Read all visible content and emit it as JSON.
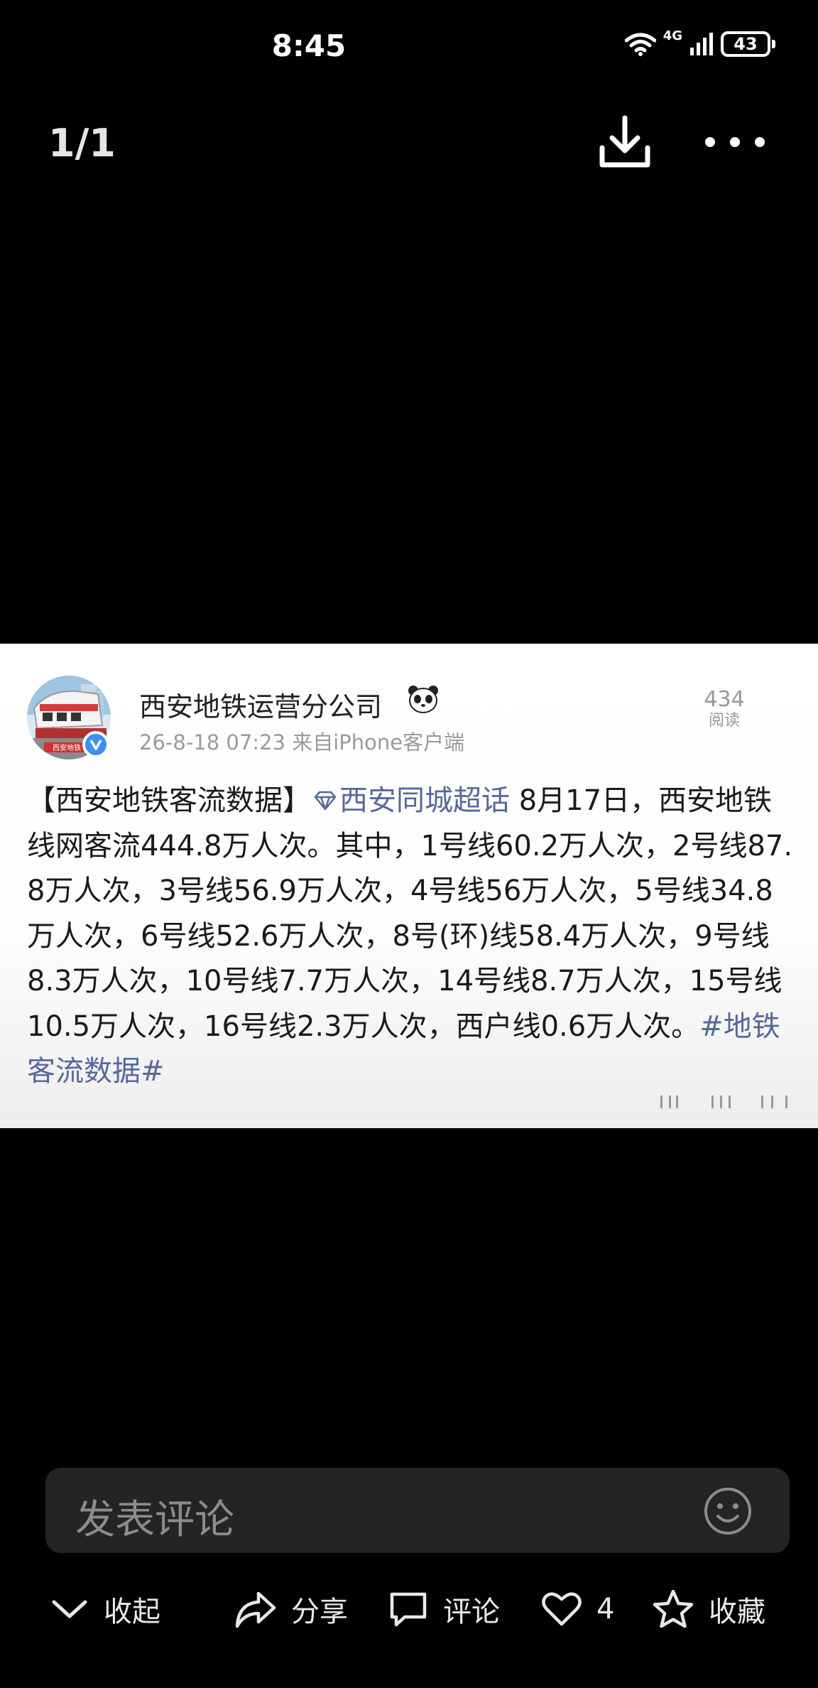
{
  "status_bar": {
    "time": "8:45",
    "network": "4G",
    "battery": "43",
    "icons": [
      "wifi-icon",
      "cellular-signal-icon",
      "battery-icon"
    ]
  },
  "viewer": {
    "page_counter": "1/1",
    "icons": [
      "download-icon",
      "more-icon"
    ]
  },
  "post": {
    "account_name": "西安地铁运营分公司",
    "avatar_text": "西安地铁",
    "meta": "26-8-18 07:23  来自iPhone客户端",
    "read_count": "434",
    "read_label": "阅读",
    "title": "【西安地铁客流数据】",
    "topic": "西安同城超话",
    "body": " 8月17日，西安地铁线网客流444.8万人次。其中，1号线60.2万人次，2号线87.8万人次，3号线56.9万人次，4号线56万人次，5号线34.8万人次，6号线52.6万人次，8号(环)线58.4万人次，9号线8.3万人次，10号线7.7万人次，14号线8.7万人次，15号线10.5万人次，16号线2.3万人次，西户线0.6万人次。",
    "hashtag": "#地铁客流数据#"
  },
  "comment": {
    "placeholder": "发表评论"
  },
  "actions": {
    "collapse": "收起",
    "share": "分享",
    "comment": "评论",
    "like_count": "4",
    "favorite": "收藏"
  },
  "colors": {
    "background": "#000000",
    "topic_link": "#56699a",
    "verified": "#3d8ff0",
    "input_bg": "#242424"
  }
}
